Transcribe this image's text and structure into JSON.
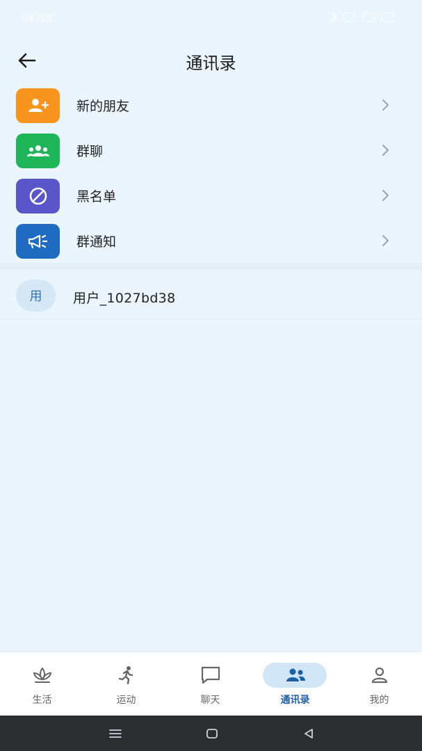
{
  "status_bar": {
    "time": "08:58"
  },
  "header": {
    "title": "通讯录"
  },
  "menu": [
    {
      "label": "新的朋友",
      "icon": "add-user-icon",
      "color": "#f7941d"
    },
    {
      "label": "群聊",
      "icon": "group-icon",
      "color": "#1fb65a"
    },
    {
      "label": "黑名单",
      "icon": "block-icon",
      "color": "#5a55c9"
    },
    {
      "label": "群通知",
      "icon": "megaphone-icon",
      "color": "#1f6bc2"
    }
  ],
  "contacts": [
    {
      "avatar_text": "用",
      "name": "用户_1027bd38"
    }
  ],
  "bottom_nav": {
    "active": "通讯录",
    "items": [
      {
        "label": "生活",
        "icon": "lotus-icon"
      },
      {
        "label": "运动",
        "icon": "running-icon"
      },
      {
        "label": "聊天",
        "icon": "chat-bubble-icon"
      },
      {
        "label": "通讯录",
        "icon": "contacts-icon"
      },
      {
        "label": "我的",
        "icon": "profile-icon"
      }
    ]
  },
  "colors": {
    "background": "#eaf5fd",
    "accent": "#1d5fa6",
    "nav_pill": "#d3e6f7"
  }
}
